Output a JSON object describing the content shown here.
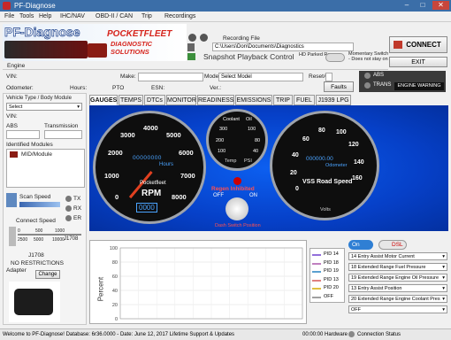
{
  "window": {
    "title": "PF-Diagnose",
    "controls": [
      "–",
      "□",
      "✕"
    ]
  },
  "menu": [
    "File",
    "Tools",
    "Help",
    "IHC/NAV",
    "OBD-II / CAN",
    "Trip",
    "Recordings"
  ],
  "brand": {
    "app_name": "PF-Diagnose",
    "logo_text": "POCKETFLEET",
    "logo_sub": "DIAGNOSTIC SOLUTIONS"
  },
  "recording": {
    "label": "Recording File",
    "path": "C:\\Users\\Don\\Documents\\Diagnostics",
    "playback_label": "Snapshot Playback Control",
    "hd_parked": "HD Parked Regen",
    "momentary": "Momentary Switch - Does not stay on"
  },
  "buttons": {
    "connect": "CONNECT",
    "exit": "EXIT",
    "faults": "Faults",
    "engine_warning": "ENGINE WARNING",
    "change": "Change"
  },
  "indicators": {
    "abs": "ABS",
    "trans": "TRANS"
  },
  "engine_section": {
    "label": "Engine",
    "vin": "VIN:",
    "make": "Make:",
    "model": "Model",
    "model_placeholder": "Select Model",
    "reset": "Reset#",
    "odometer": "Odometer:",
    "hours": "Hours:",
    "pto": "PTO",
    "esn": "ESN:",
    "ver": "Ver.:"
  },
  "left_panel": {
    "vehicle_type": "Vehicle Type / Body Module",
    "select": "Select",
    "vin": "VIN:",
    "abs": "ABS",
    "transmission": "Transmission",
    "identified_modules": "Identified Modules",
    "module": "MID/Module",
    "scan_speed": "Scan Speed",
    "tx": "TX",
    "rx": "RX",
    "er": "ER",
    "connect_speed": "Connect Speed",
    "j1708_small": "J1708",
    "speed_ticks": [
      "0",
      "500",
      "1000",
      "2500",
      "5000",
      "10000"
    ],
    "j1708": "J1708",
    "no_restrictions": "NO RESTRICTIONS",
    "adapter": "Adapter"
  },
  "tabs": [
    "GAUGES",
    "TEMPS",
    "DTCs",
    "MONITOR",
    "READINESS",
    "EMISSIONS",
    "TRIP",
    "FUEL",
    "J1939 LPG"
  ],
  "gauges": {
    "rpm": {
      "title": "RPM",
      "brand": "Pocketfleet",
      "hours_label": "Hours",
      "ticks": [
        "0",
        "1000",
        "2000",
        "3000",
        "4000",
        "5000",
        "6000",
        "7000",
        "8000"
      ],
      "hours_value": "00000000",
      "rpm_value": "0000"
    },
    "small": {
      "coolant": "Coolant",
      "oil": "Oil",
      "temp": "Temp",
      "psi": "PSI",
      "ticks": [
        "300",
        "100",
        "200",
        "80",
        "40",
        "100"
      ]
    },
    "speed": {
      "title": "VSS Road Speed",
      "odometer": "Odometer",
      "volts": "Volts",
      "ticks": [
        "40",
        "60",
        "80",
        "100",
        "120",
        "140",
        "160",
        "20",
        "0"
      ],
      "odo_value": "000000.00"
    },
    "regen": {
      "line1": "Regen Inhibited",
      "off": "OFF",
      "on": "ON",
      "dash_switch": "Dash Switch Position"
    }
  },
  "chart_label": "J1708",
  "chart": {
    "ylabel": "Percent",
    "yticks": [
      "100",
      "80",
      "60",
      "40",
      "20",
      "0"
    ]
  },
  "chart_data": {
    "type": "line",
    "ylabel": "Percent",
    "ylim": [
      0,
      100
    ],
    "series": [
      {
        "name": "PID 14",
        "values": []
      },
      {
        "name": "PID 18",
        "values": []
      },
      {
        "name": "PID 19",
        "values": []
      },
      {
        "name": "PID 13",
        "values": []
      },
      {
        "name": "PID 20",
        "values": []
      },
      {
        "name": "OFF",
        "values": []
      }
    ]
  },
  "legend": [
    "PID 14",
    "PID 18",
    "PID 19",
    "PID 13",
    "PID 20",
    "OFF"
  ],
  "legend_colors": [
    "#9370db",
    "#c080c0",
    "#5aa0d0",
    "#e08080",
    "#e0c040",
    "#a0a0a0"
  ],
  "toggles": {
    "on": "On",
    "dsl": "DSL"
  },
  "selects": [
    "14 Entry Assist Motor Current",
    "18 Extended Range Fuel Pressure",
    "19 Extended Range Engine Oil Pressure",
    "13 Entry Assist Position",
    "20 Extended Range Engine Coolant Pres",
    "OFF"
  ],
  "status": {
    "message": "Welcome to PF-Diagnose! Database: 6r36.0000 - Date: June 12, 2017 Lifetime Support & Updates",
    "time": "00:00:00",
    "hardware": "Hardware",
    "connection": "Connection Status"
  }
}
